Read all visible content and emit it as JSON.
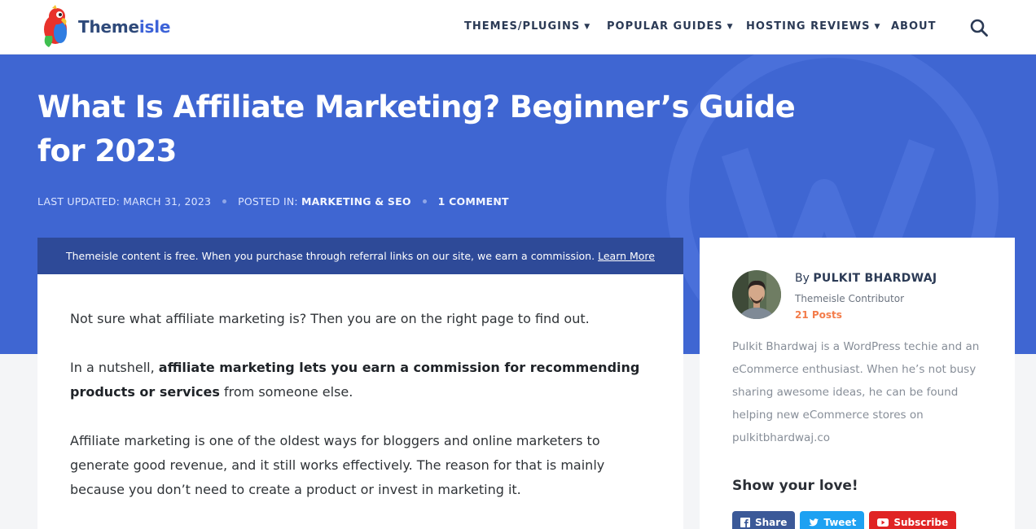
{
  "brand": {
    "name_part1": "Theme",
    "name_part2": "isle"
  },
  "nav": {
    "items": [
      {
        "label": "THEMES/PLUGINS",
        "has_dropdown": true
      },
      {
        "label": "POPULAR GUIDES",
        "has_dropdown": true
      },
      {
        "label": "HOSTING REVIEWS",
        "has_dropdown": true
      },
      {
        "label": "ABOUT",
        "has_dropdown": false
      }
    ],
    "search_icon": "search-icon"
  },
  "article": {
    "title": "What Is Affiliate Marketing? Beginner’s Guide for 2023",
    "meta": {
      "last_updated": "LAST UPDATED: MARCH 31, 2023",
      "posted_in_label": "POSTED IN:",
      "category": "MARKETING & SEO",
      "comments": "1 COMMENT"
    },
    "notice": {
      "text": "Themeisle content is free. When you purchase through referral links on our site, we earn a commission.",
      "link": "Learn More"
    },
    "paragraphs": {
      "p1": "Not sure what affiliate marketing is? Then you are on the right page to find out.",
      "p2_before": "In a nutshell, ",
      "p2_bold": "affiliate marketing lets you earn a commission for recommending products or services",
      "p2_after": " from someone else.",
      "p3": "Affiliate marketing is one of the oldest ways for bloggers and online marketers to generate good revenue, and it still works effectively. The reason for that is mainly because you don’t need to create a product or invest in marketing it."
    }
  },
  "author": {
    "by_label": "By",
    "name": "PULKIT BHARDWAJ",
    "role": "Themeisle Contributor",
    "posts": "21 Posts",
    "bio": "Pulkit Bhardwaj is a WordPress techie and an eCommerce enthusiast. When he’s not busy sharing awesome ideas, he can be found helping new eCommerce stores on pulkitbhardwaj.co"
  },
  "share": {
    "heading": "Show your love!",
    "buttons": [
      {
        "label": "Share",
        "icon": "facebook-icon",
        "color": "#3b5998"
      },
      {
        "label": "Tweet",
        "icon": "twitter-icon",
        "color": "#1da1f2"
      },
      {
        "label": "Subscribe",
        "icon": "youtube-icon",
        "color": "#e02424"
      }
    ]
  },
  "colors": {
    "hero": "#3f66d2",
    "notice": "#2e4a98",
    "accent": "#f37c4a"
  }
}
